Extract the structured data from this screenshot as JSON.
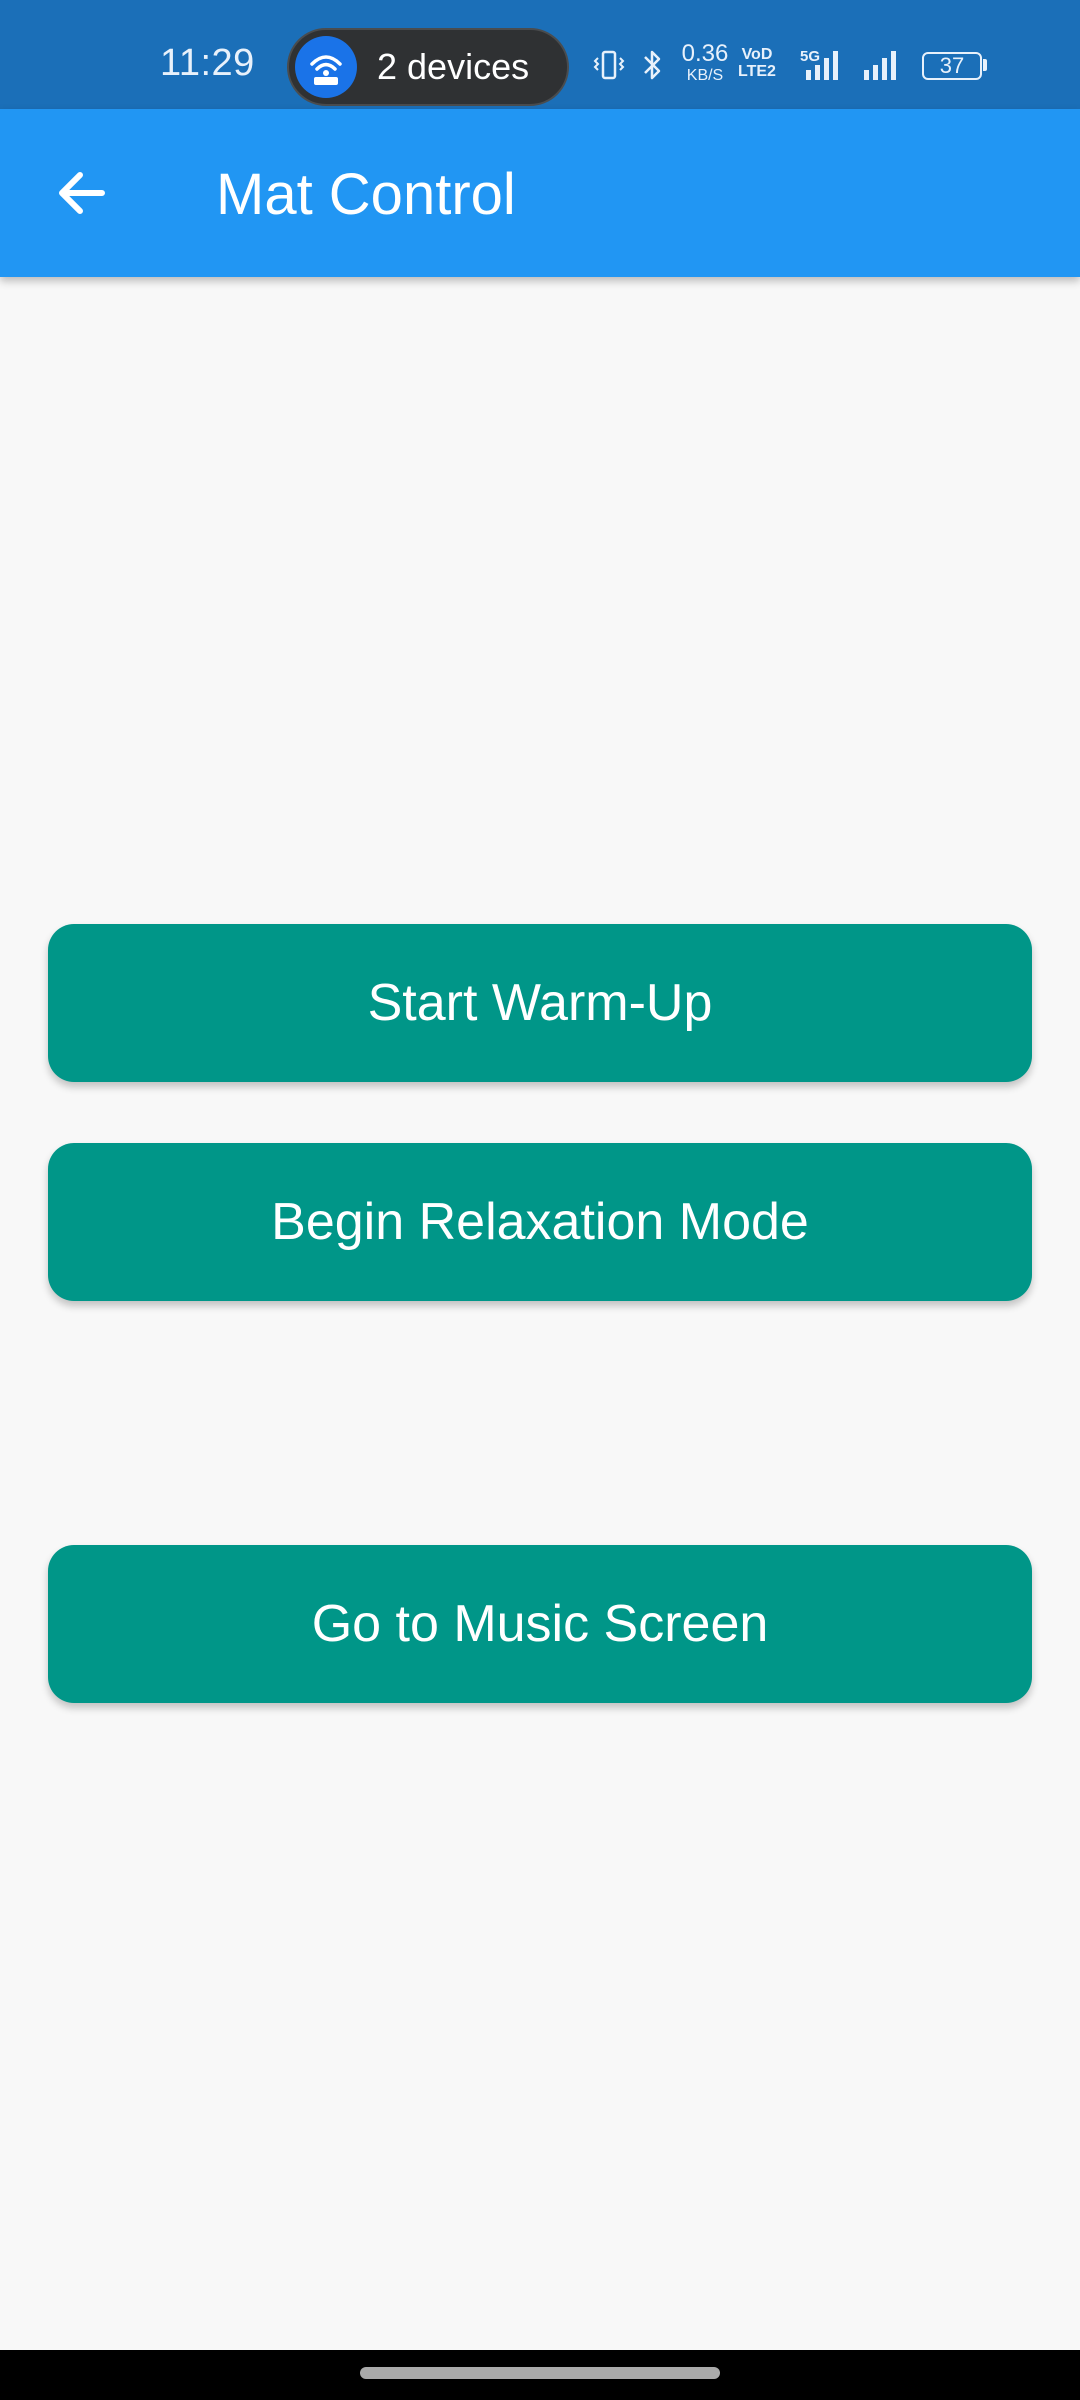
{
  "status_bar": {
    "time": "11:29",
    "hotspot_label": "2 devices",
    "net_speed_value": "0.36",
    "net_speed_unit": "KB/S",
    "volte_top": "VoD",
    "volte_bottom": "LTE2",
    "signal_label": "5G",
    "battery": "37",
    "icons": [
      "hotspot-icon",
      "vibrate-icon",
      "bluetooth-icon",
      "signal-5g-icon",
      "signal-icon",
      "battery-icon"
    ]
  },
  "app_bar": {
    "title": "Mat Control",
    "back_icon": "arrow-back-icon",
    "color": "#2196f3"
  },
  "buttons": {
    "warm_up": "Start Warm-Up",
    "relaxation": "Begin Relaxation Mode",
    "music": "Go to Music Screen",
    "color": "#009688"
  }
}
